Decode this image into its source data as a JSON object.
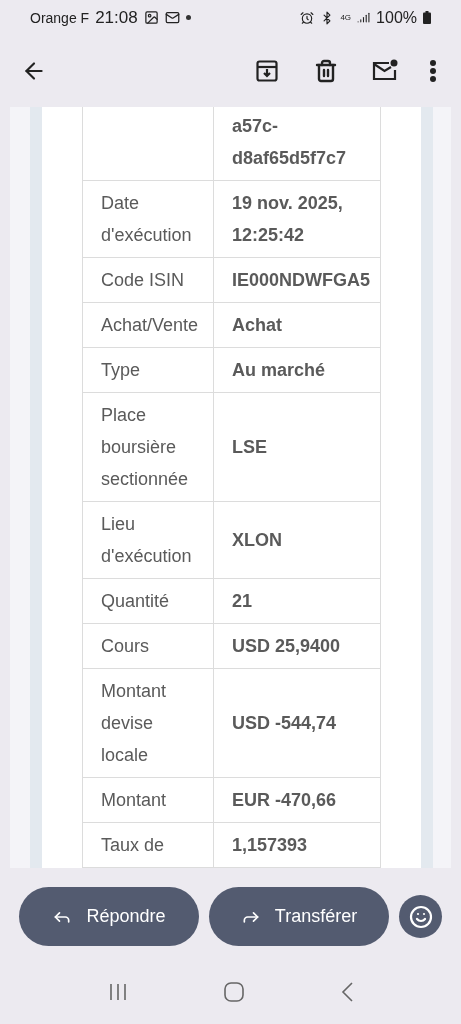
{
  "status_bar": {
    "carrier": "Orange F",
    "time": "21:08",
    "network": "4G",
    "battery": "100%"
  },
  "rows": [
    {
      "value": "a57c-d8af65d5f7c7"
    },
    {
      "label": "Date d'exécution",
      "value": "19 nov. 2025, 12:25:42"
    },
    {
      "label": "Code ISIN",
      "value": "IE000NDWFGA5"
    },
    {
      "label": "Achat/Vente",
      "value": "Achat"
    },
    {
      "label": "Type",
      "value": "Au marché"
    },
    {
      "label": "Place boursière sectionnée",
      "value": "LSE"
    },
    {
      "label": "Lieu d'exécution",
      "value": "XLON"
    },
    {
      "label": "Quantité",
      "value": "21"
    },
    {
      "label": "Cours",
      "value": "USD 25,9400"
    },
    {
      "label": "Montant devise locale",
      "value": "USD -544,74"
    },
    {
      "label": "Montant",
      "value": "EUR -470,66"
    },
    {
      "label": "Taux de",
      "value": "1,157393"
    }
  ],
  "actions": [
    {
      "kind": "reply",
      "label": "Répondre"
    },
    {
      "kind": "forward",
      "label": "Transférer"
    }
  ]
}
